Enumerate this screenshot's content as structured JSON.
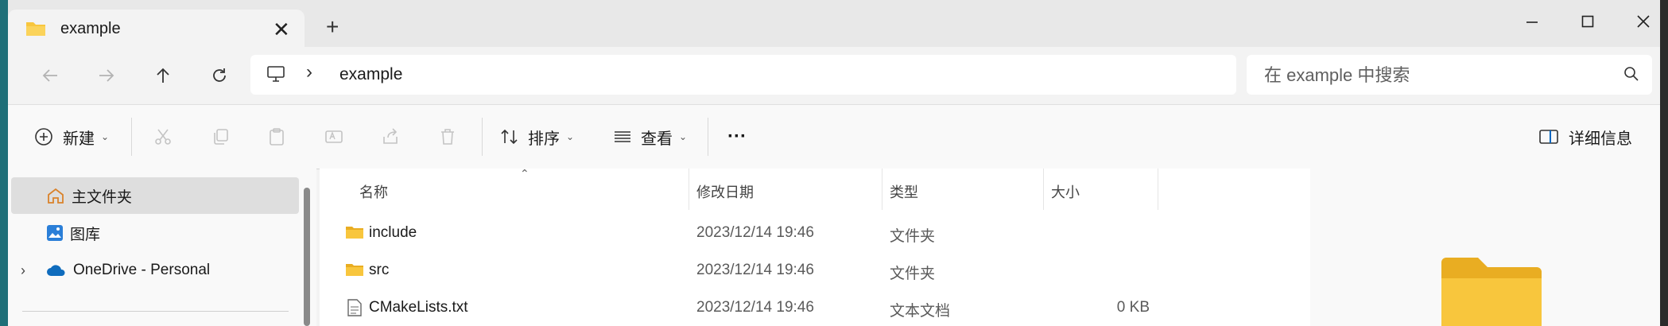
{
  "window": {
    "tab_title": "example",
    "new_tab_symbol": "+",
    "close_tab_symbol": "✕"
  },
  "address": {
    "breadcrumb": "example",
    "search_placeholder": "在 example 中搜索"
  },
  "commands": {
    "new_label": "新建",
    "sort_label": "排序",
    "view_label": "查看",
    "more_symbol": "···",
    "details_label": "详细信息"
  },
  "nav": {
    "items": [
      {
        "label": "主文件夹"
      },
      {
        "label": "图库"
      },
      {
        "label": "OneDrive - Personal"
      }
    ]
  },
  "list": {
    "columns": [
      "名称",
      "修改日期",
      "类型",
      "大小"
    ],
    "rows": [
      {
        "name": "include",
        "date": "2023/12/14 19:46",
        "type": "文件夹",
        "size": ""
      },
      {
        "name": "src",
        "date": "2023/12/14 19:46",
        "type": "文件夹",
        "size": ""
      },
      {
        "name": "CMakeLists.txt",
        "date": "2023/12/14 19:46",
        "type": "文本文档",
        "size": "0 KB"
      }
    ]
  },
  "colors": {
    "accent": "#0067c0",
    "folder_yellow": "#f8c63d",
    "selection": "#dedede"
  }
}
